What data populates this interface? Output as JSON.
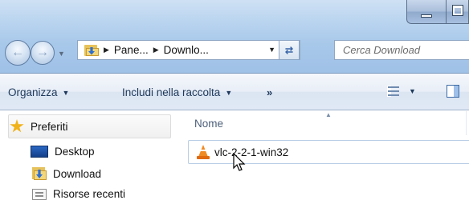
{
  "window": {
    "minimize_icon": "minimize-icon",
    "maximize_icon": "maximize-icon"
  },
  "navigation": {
    "back_icon": "back-arrow-icon",
    "forward_icon": "forward-arrow-icon"
  },
  "address_bar": {
    "breadcrumbs": [
      "Pane...",
      "Downlo..."
    ],
    "refresh_icon": "refresh-icon"
  },
  "search": {
    "placeholder": "Cerca Download"
  },
  "command_bar": {
    "organize_label": "Organizza",
    "include_label": "Includi nella raccolta",
    "more_label": "»"
  },
  "sidebar": {
    "items": [
      {
        "label": "Preferiti",
        "icon": "star-icon"
      },
      {
        "label": "Desktop",
        "icon": "desktop-icon"
      },
      {
        "label": "Download",
        "icon": "download-folder-icon"
      },
      {
        "label": "Risorse recenti",
        "icon": "recent-places-icon"
      }
    ]
  },
  "file_list": {
    "column_header": "Nome",
    "files": [
      {
        "name": "vlc-2-2-1-win32",
        "icon": "vlc-icon"
      }
    ]
  },
  "colors": {
    "aero_blue": "#b9d4ef",
    "command_bar": "#e8eef7",
    "selection_border": "#b8cde6"
  }
}
